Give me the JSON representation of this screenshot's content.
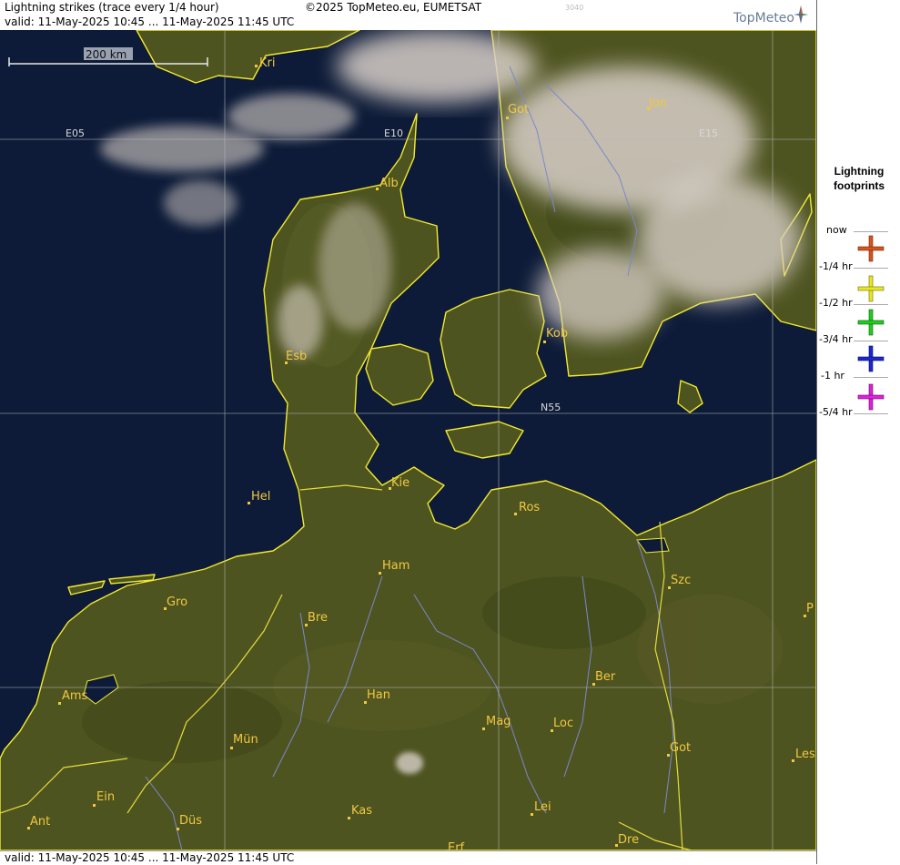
{
  "header": {
    "title": "Lightning strikes (trace every 1/4 hour)",
    "copyright": "©2025 TopMeteo.eu, EUMETSAT",
    "image_id": "3040",
    "valid": "valid:  11-May-2025 10:45 ... 11-May-2025 11:45 UTC",
    "logo": "TopMeteo"
  },
  "footer": {
    "valid": "valid:  11-May-2025 10:45 ... 11-May-2025 11:45 UTC"
  },
  "scale": {
    "label": "200 km"
  },
  "grid": {
    "e05": "E05",
    "e10": "E10",
    "e15": "E15",
    "n55": "N55"
  },
  "cities": {
    "kri": "Kri",
    "got1": "Got",
    "jon": "Jon",
    "alb": "Alb",
    "kob": "Kob",
    "esb": "Esb",
    "kie": "Kie",
    "hel": "Hel",
    "ros": "Ros",
    "ham": "Ham",
    "szc": "Szc",
    "gro": "Gro",
    "bre": "Bre",
    "p": "P",
    "ber": "Ber",
    "ams": "Ams",
    "han": "Han",
    "mag": "Mag",
    "loc": "Loc",
    "mun": "Mün",
    "got2": "Got",
    "les": "Les",
    "ein": "Ein",
    "kas": "Kas",
    "lei": "Lei",
    "ant": "Ant",
    "dus": "Düs",
    "erf": "Erf",
    "dre": "Dre"
  },
  "legend": {
    "title_line1": "Lightning",
    "title_line2": "footprints",
    "items": [
      {
        "label": "now",
        "color": "#d8541c"
      },
      {
        "label": "-1/4 hr",
        "color": "#e8e820"
      },
      {
        "label": "-1/2 hr",
        "color": "#22cc22"
      },
      {
        "label": "-3/4 hr",
        "color": "#1a2ad0"
      },
      {
        "label": "-1 hr",
        "color": "#e020e0"
      },
      {
        "label": "-5/4 hr",
        "color": ""
      }
    ]
  },
  "colors": {
    "sea": "#0d1b38",
    "land": "#4e5420",
    "coast": "#f2ea30",
    "border": "#e4dc3a",
    "river": "#7d87cc",
    "city": "#f0c840",
    "cloud": "#d8cfc8"
  }
}
